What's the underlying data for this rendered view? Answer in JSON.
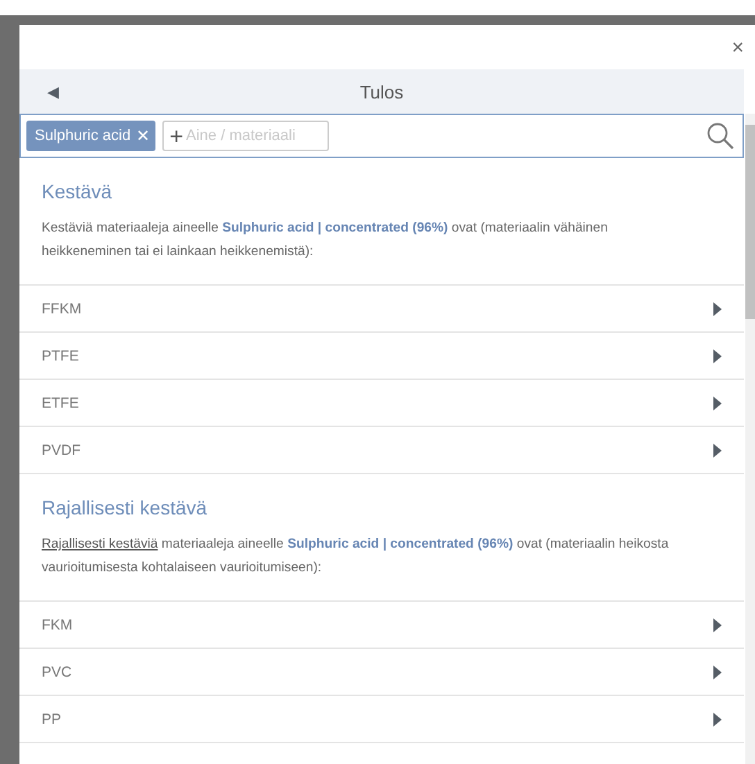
{
  "dialog": {
    "close": "×",
    "header": {
      "back": "◀",
      "title": "Tulos"
    },
    "search": {
      "chips": [
        {
          "label": "Sulphuric acid",
          "remove": "✕"
        }
      ],
      "add": {
        "icon": "+",
        "placeholder": "Aine / materiaali"
      }
    },
    "sections": [
      {
        "title": "Kestävä",
        "description": {
          "text": "Kestäviä materiaaleja aineelle **Sulphuric acid | concentrated (96%)** ovat (materiaalin vähäinen heikkeneminen tai ei lainkaan heikkenemistä):"
        },
        "items": [
          {
            "label": "FFKM"
          },
          {
            "label": "PTFE"
          },
          {
            "label": "ETFE"
          },
          {
            "label": "PVDF"
          }
        ]
      },
      {
        "title": "Rajallisesti kestävä",
        "description": {
          "link": "Rajallisesti kestäviä",
          "text": " materiaaleja aineelle **Sulphuric acid | concentrated (96%)** ovat (materiaalin heikosta vaurioitumisesta kohtalaiseen vaurioitumiseen):"
        },
        "items": [
          {
            "label": "FKM"
          },
          {
            "label": "PVC"
          },
          {
            "label": "PP"
          }
        ]
      }
    ]
  }
}
